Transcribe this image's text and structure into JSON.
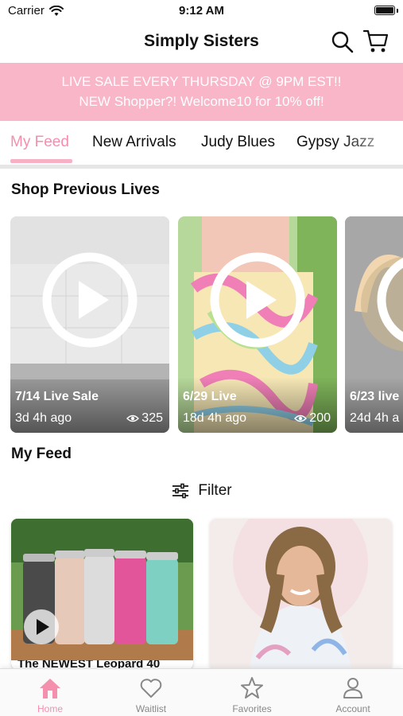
{
  "status_bar": {
    "carrier": "Carrier",
    "time": "9:12 AM"
  },
  "nav": {
    "title": "Simply Sisters"
  },
  "promo": {
    "line1": "LIVE SALE EVERY THURSDAY @ 9PM EST!!",
    "line2": "NEW Shopper?! Welcome10 for 10% off!"
  },
  "tabs": [
    {
      "label": "My Feed",
      "active": true
    },
    {
      "label": "New Arrivals"
    },
    {
      "label": "Judy Blues"
    },
    {
      "label": "Gypsy Jazz"
    }
  ],
  "sections": {
    "previous_lives": "Shop Previous Lives",
    "feed": "My Feed"
  },
  "lives": [
    {
      "title": "7/14 Live Sale",
      "age": "3d 4h ago",
      "views": "325"
    },
    {
      "title": "6/29 Live",
      "age": "18d 4h ago",
      "views": "200"
    },
    {
      "title": "6/23 live",
      "age": "24d 4h a",
      "views": ""
    }
  ],
  "filter": {
    "label": "Filter"
  },
  "products": [
    {
      "caption": "The NEWEST Leopard 40"
    },
    {
      "caption": ""
    }
  ],
  "tab_bar": [
    {
      "label": "Home",
      "icon": "home-icon",
      "active": true
    },
    {
      "label": "Waitlist",
      "icon": "heart-icon"
    },
    {
      "label": "Favorites",
      "icon": "star-icon"
    },
    {
      "label": "Account",
      "icon": "person-icon"
    }
  ],
  "colors": {
    "accent": "#f58fae",
    "banner": "#f8b6c8"
  }
}
